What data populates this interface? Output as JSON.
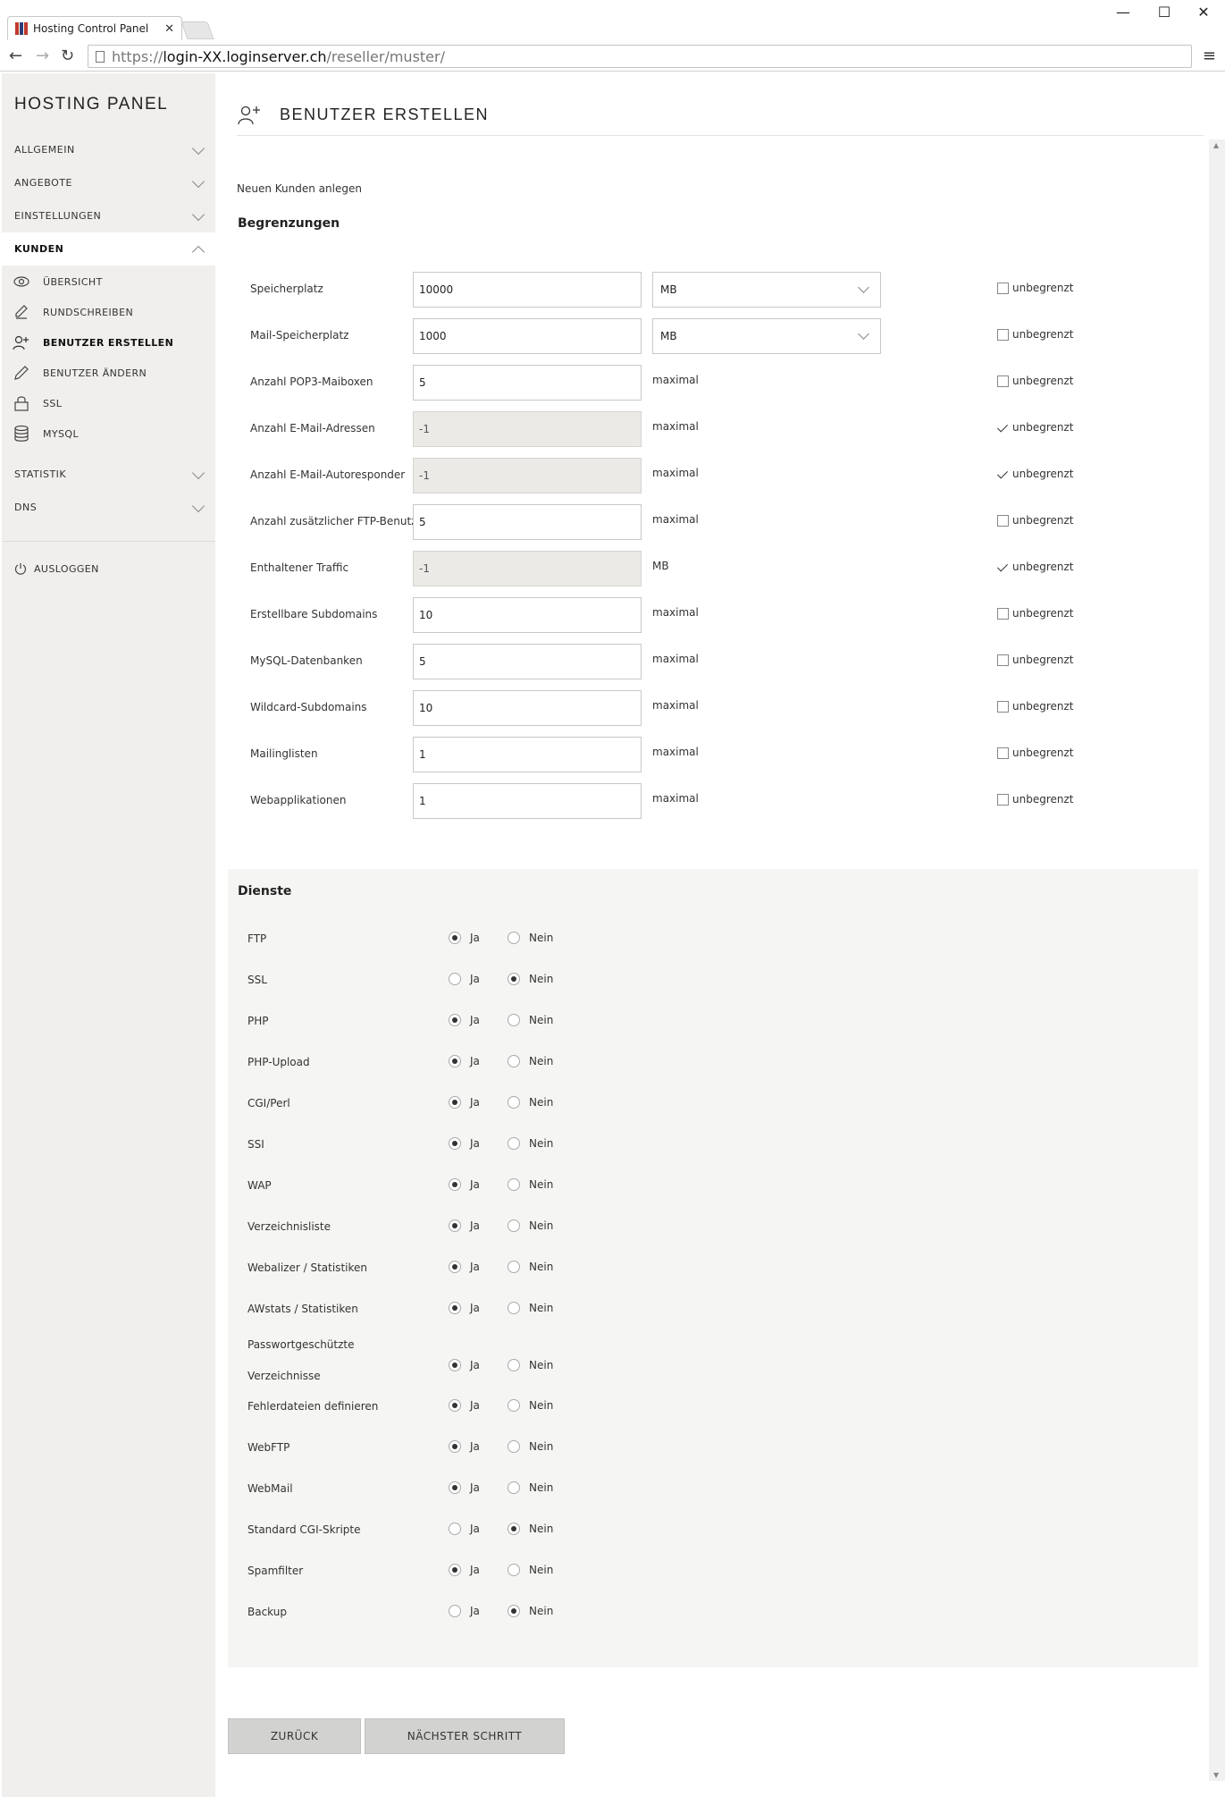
{
  "browser": {
    "tab_title": "Hosting Control Panel",
    "tab_close": "✕",
    "url_scheme": "https://",
    "url_host": "login-XX.loginserver.ch",
    "url_path": "/reseller/muster/",
    "win_min": "—",
    "win_max": "☐",
    "win_close": "✕",
    "back": "←",
    "forward": "→",
    "reload": "↻",
    "menu": "≡"
  },
  "sidebar": {
    "brand": "HOSTING PANEL",
    "sections": [
      {
        "label": "ALLGEMEIN"
      },
      {
        "label": "ANGEBOTE"
      },
      {
        "label": "EINSTELLUNGEN"
      },
      {
        "label": "KUNDEN"
      }
    ],
    "submenu": [
      {
        "label": "ÜBERSICHT",
        "icon": "eye-icon"
      },
      {
        "label": "RUNDSCHREIBEN",
        "icon": "pen-icon"
      },
      {
        "label": "BENUTZER ERSTELLEN",
        "icon": "user-add-icon"
      },
      {
        "label": "BENUTZER ÄNDERN",
        "icon": "pencil-icon"
      },
      {
        "label": "SSL",
        "icon": "lock-icon"
      },
      {
        "label": "MYSQL",
        "icon": "database-icon"
      }
    ],
    "sections_after": [
      {
        "label": "STATISTIK"
      },
      {
        "label": "DNS"
      }
    ],
    "logout": "AUSLOGGEN"
  },
  "main": {
    "title": "BENUTZER ERSTELLEN",
    "subtitle": "Neuen Kunden anlegen",
    "limits_title": "Begrenzungen",
    "unlimited_label": "unbegrenzt",
    "limits": [
      {
        "label": "Speicherplatz",
        "value": "10000",
        "unit": "MB",
        "unit_is_select": true,
        "disabled": false,
        "unlimited": false
      },
      {
        "label": "Mail-Speicherplatz",
        "value": "1000",
        "unit": "MB",
        "unit_is_select": true,
        "disabled": false,
        "unlimited": false
      },
      {
        "label": "Anzahl POP3-Maiboxen",
        "value": "5",
        "unit": "maximal",
        "unit_is_select": false,
        "disabled": false,
        "unlimited": false
      },
      {
        "label": "Anzahl E-Mail-Adressen",
        "value": "-1",
        "unit": "maximal",
        "unit_is_select": false,
        "disabled": true,
        "unlimited": true
      },
      {
        "label": "Anzahl E-Mail-Autoresponder",
        "value": "-1",
        "unit": "maximal",
        "unit_is_select": false,
        "disabled": true,
        "unlimited": true
      },
      {
        "label": "Anzahl zusätzlicher FTP-Benutzer",
        "value": "5",
        "unit": "maximal",
        "unit_is_select": false,
        "disabled": false,
        "unlimited": false
      },
      {
        "label": "Enthaltener Traffic",
        "value": "-1",
        "unit": "MB",
        "unit_is_select": false,
        "disabled": true,
        "unlimited": true
      },
      {
        "label": "Erstellbare Subdomains",
        "value": "10",
        "unit": "maximal",
        "unit_is_select": false,
        "disabled": false,
        "unlimited": false
      },
      {
        "label": "MySQL-Datenbanken",
        "value": "5",
        "unit": "maximal",
        "unit_is_select": false,
        "disabled": false,
        "unlimited": false
      },
      {
        "label": "Wildcard-Subdomains",
        "value": "10",
        "unit": "maximal",
        "unit_is_select": false,
        "disabled": false,
        "unlimited": false
      },
      {
        "label": "Mailinglisten",
        "value": "1",
        "unit": "maximal",
        "unit_is_select": false,
        "disabled": false,
        "unlimited": false
      },
      {
        "label": "Webapplikationen",
        "value": "1",
        "unit": "maximal",
        "unit_is_select": false,
        "disabled": false,
        "unlimited": false
      }
    ],
    "services_title": "Dienste",
    "yes_label": "Ja",
    "no_label": "Nein",
    "services": [
      {
        "label": "FTP",
        "value": "ja"
      },
      {
        "label": "SSL",
        "value": "nein"
      },
      {
        "label": "PHP",
        "value": "ja"
      },
      {
        "label": "PHP-Upload",
        "value": "ja"
      },
      {
        "label": "CGI/Perl",
        "value": "ja"
      },
      {
        "label": "SSI",
        "value": "ja"
      },
      {
        "label": "WAP",
        "value": "ja"
      },
      {
        "label": "Verzeichnisliste",
        "value": "ja"
      },
      {
        "label": "Webalizer / Statistiken",
        "value": "ja"
      },
      {
        "label": "AWstats / Statistiken",
        "value": "ja"
      },
      {
        "label": "Passwortgeschützte Verzeichnisse",
        "label_line1": "Passwortgeschützte",
        "label_line2": "Verzeichnisse",
        "value": "ja"
      },
      {
        "label": "Fehlerdateien definieren",
        "value": "ja"
      },
      {
        "label": "WebFTP",
        "value": "ja"
      },
      {
        "label": "WebMail",
        "value": "ja"
      },
      {
        "label": "Standard CGI-Skripte",
        "value": "nein"
      },
      {
        "label": "Spamfilter",
        "value": "ja"
      },
      {
        "label": "Backup",
        "value": "nein"
      }
    ],
    "back_button": "ZURÜCK",
    "next_button": "NÄCHSTER SCHRITT"
  }
}
